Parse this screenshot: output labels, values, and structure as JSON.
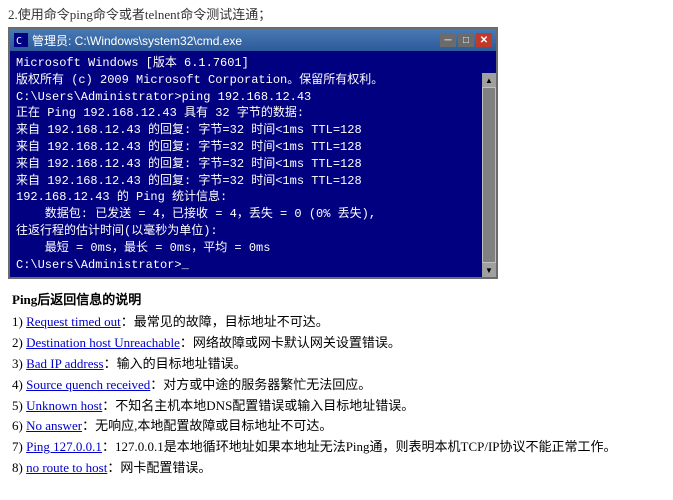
{
  "instruction": "2.使用命令ping命令或者telnent命令测试连通；",
  "cmd": {
    "titlebar": "管理员: C:\\Windows\\system32\\cmd.exe",
    "lines": [
      {
        "text": "Microsoft Windows [版本 6.1.7601]",
        "class": "white"
      },
      {
        "text": "版权所有 (c) 2009 Microsoft Corporation。保留所有权利。",
        "class": "white"
      },
      {
        "text": "",
        "class": ""
      },
      {
        "text": "C:\\Users\\Administrator>ping 192.168.12.43",
        "class": "white"
      },
      {
        "text": "",
        "class": ""
      },
      {
        "text": "正在 Ping 192.168.12.43 具有 32 字节的数据:",
        "class": "white"
      },
      {
        "text": "来自 192.168.12.43 的回复: 字节=32 时间<1ms TTL=128",
        "class": "white"
      },
      {
        "text": "来自 192.168.12.43 的回复: 字节=32 时间<1ms TTL=128",
        "class": "white"
      },
      {
        "text": "来自 192.168.12.43 的回复: 字节=32 时间<1ms TTL=128",
        "class": "white"
      },
      {
        "text": "来自 192.168.12.43 的回复: 字节=32 时间<1ms TTL=128",
        "class": "white"
      },
      {
        "text": "",
        "class": ""
      },
      {
        "text": "192.168.12.43 的 Ping 统计信息:",
        "class": "white"
      },
      {
        "text": "    数据包: 已发送 = 4，已接收 = 4，丢失 = 0 (0% 丢失),",
        "class": "white"
      },
      {
        "text": "往返行程的估计时间(以毫秒为单位):",
        "class": "white"
      },
      {
        "text": "    最短 = 0ms，最长 = 0ms，平均 = 0ms",
        "class": "white"
      },
      {
        "text": "",
        "class": ""
      },
      {
        "text": "C:\\Users\\Administrator>_",
        "class": "white"
      }
    ]
  },
  "ping_info": {
    "title": "Ping后返回信息的说明",
    "items": [
      {
        "num": "1) ",
        "label": "Request timed out",
        "separator": "：最常见的故障，目标地址不可达。"
      },
      {
        "num": "2) ",
        "label": "Destination host Unreachable",
        "separator": "：网络故障或网卡默认网关设置错误。"
      },
      {
        "num": "3) ",
        "label": "Bad IP address",
        "separator": "：输入的目标地址错误。"
      },
      {
        "num": "4) ",
        "label": "Source quench received",
        "separator": "：对方或中途的服务器繁忙无法回应。"
      },
      {
        "num": "5) ",
        "label": "Unknown host",
        "separator": "：不知名主机本地DNS配置错误或输入目标地址错误。"
      },
      {
        "num": "6) ",
        "label": "No answer",
        "separator": "：无响应,本地配置故障或目标地址不可达。"
      },
      {
        "num": "7) ",
        "label": "Ping 127.0.0.1",
        "separator": "：127.0.0.1是本地循环地址如果本地址无法Ping通，则表明本机TCP/IP协议不能正常工作。"
      },
      {
        "num": "8) ",
        "label": "no route to host",
        "separator": "：网卡配置错误。"
      }
    ]
  }
}
